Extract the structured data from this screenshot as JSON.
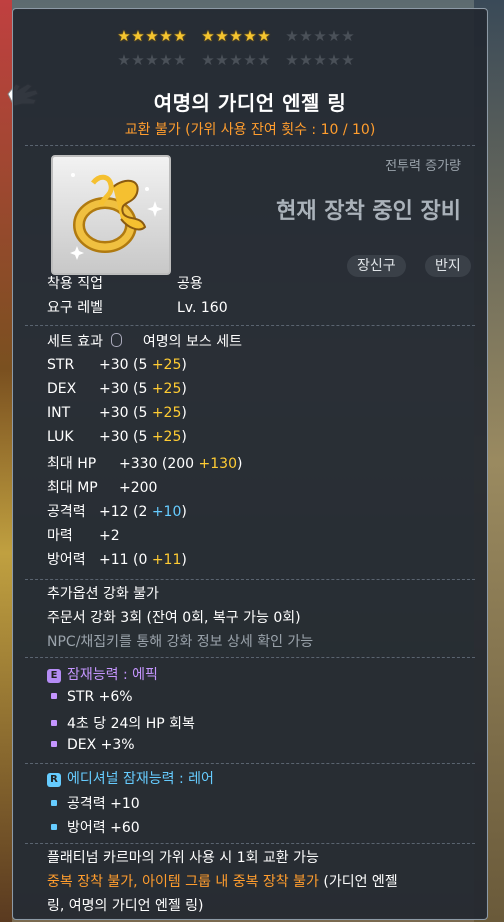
{
  "stars": {
    "row1": [
      1,
      1,
      1,
      1,
      1,
      1,
      1,
      1,
      1,
      1,
      0,
      0,
      0,
      0,
      0
    ],
    "row2": [
      0,
      0,
      0,
      0,
      0,
      0,
      0,
      0,
      0,
      0,
      0,
      0,
      0,
      0,
      0
    ]
  },
  "item": {
    "name": "여명의 가디언 엔젤 링",
    "trade": "교환 불가 (가위 사용 잔여 횟수 : 10 / 10)",
    "cp_label": "전투력 증가량",
    "cp_value": "현재 장착 중인 장비",
    "tags": [
      "장신구",
      "반지"
    ]
  },
  "req": [
    {
      "k": "착용 직업",
      "v": "공용"
    },
    {
      "k": "요구 레벨",
      "v": "Lv. 160"
    }
  ],
  "set": {
    "label": "세트 효과",
    "name": "여명의 보스 세트"
  },
  "stats": [
    {
      "k": "STR",
      "base": "+30",
      "detail": " (5 ",
      "extra": "+25",
      "close": ")",
      "color": "gold"
    },
    {
      "k": "DEX",
      "base": "+30",
      "detail": " (5 ",
      "extra": "+25",
      "close": ")",
      "color": "gold"
    },
    {
      "k": "INT",
      "base": "+30",
      "detail": " (5 ",
      "extra": "+25",
      "close": ")",
      "color": "gold"
    },
    {
      "k": "LUK",
      "base": "+30",
      "detail": " (5 ",
      "extra": "+25",
      "close": ")",
      "color": "gold"
    },
    {
      "k": "최대 HP",
      "base": "+330",
      "detail": " (200 ",
      "extra": "+130",
      "close": ")",
      "color": "gold"
    },
    {
      "k": "최대 MP",
      "base": "+200",
      "detail": "",
      "extra": "",
      "close": "",
      "color": "gold"
    },
    {
      "k": "공격력",
      "base": "+12",
      "detail": " (2 ",
      "extra": "+10",
      "close": ")",
      "color": "cyan"
    },
    {
      "k": "마력",
      "base": "+2",
      "detail": "",
      "extra": "",
      "close": "",
      "color": "gold"
    },
    {
      "k": "방어력",
      "base": "+11",
      "detail": " (0 ",
      "extra": "+11",
      "close": ")",
      "color": "gold"
    }
  ],
  "notes": [
    "추가옵션 강화 불가",
    "주문서 강화 3회 (잔여 0회, 복구 가능 0회)",
    "NPC/채집키를 통해 강화 정보 상세 확인 가능"
  ],
  "potential": {
    "badge": "E",
    "title": "잠재능력 : 에픽",
    "lines": [
      "STR +6%",
      "4초 당 24의 HP 회복",
      "DEX +3%"
    ]
  },
  "additional": {
    "badge": "R",
    "title": "에디셔널 잠재능력 : 레어",
    "lines": [
      "공격력 +10",
      "방어력 +60"
    ]
  },
  "footer": {
    "karma": "플래티넘 카르마의 가위 사용 시 1회 교환 가능",
    "dup_orange": "중복 장착 불가, 아이템 그룹 내 중복 장착 불가",
    "dup_white1": " (가디언 엔젤",
    "dup_white2": "링, 여명의 가디언 엔젤 링)"
  },
  "colors": {
    "gold": "#ffcc33",
    "cyan": "#66ccff",
    "orange": "#ff9d2e",
    "epic": "#c596ff",
    "rare": "#66ccff"
  }
}
